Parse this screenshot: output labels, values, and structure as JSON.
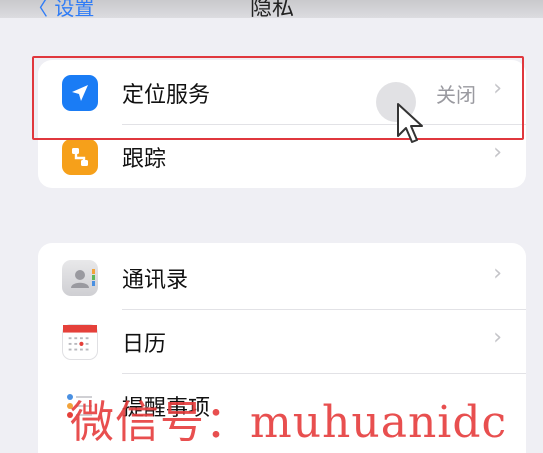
{
  "nav": {
    "back_label": "〈 设置",
    "title": "隐私"
  },
  "group1": [
    {
      "label": "定位服务",
      "value": "关闭",
      "icon": "location-arrow-icon",
      "color": "#1a7cf5"
    },
    {
      "label": "跟踪",
      "value": "",
      "icon": "tracking-icon",
      "color": "#f6a01a"
    }
  ],
  "group2": [
    {
      "label": "通讯录",
      "icon": "contacts-icon"
    },
    {
      "label": "日历",
      "icon": "calendar-icon"
    },
    {
      "label": "提醒事项",
      "icon": "reminders-icon"
    }
  ],
  "chevron": "›",
  "watermark": "微信号：muhuanidc",
  "colors": {
    "highlight": "#e0373d",
    "accent": "#1a7cf5",
    "tracking": "#f6a01a"
  }
}
